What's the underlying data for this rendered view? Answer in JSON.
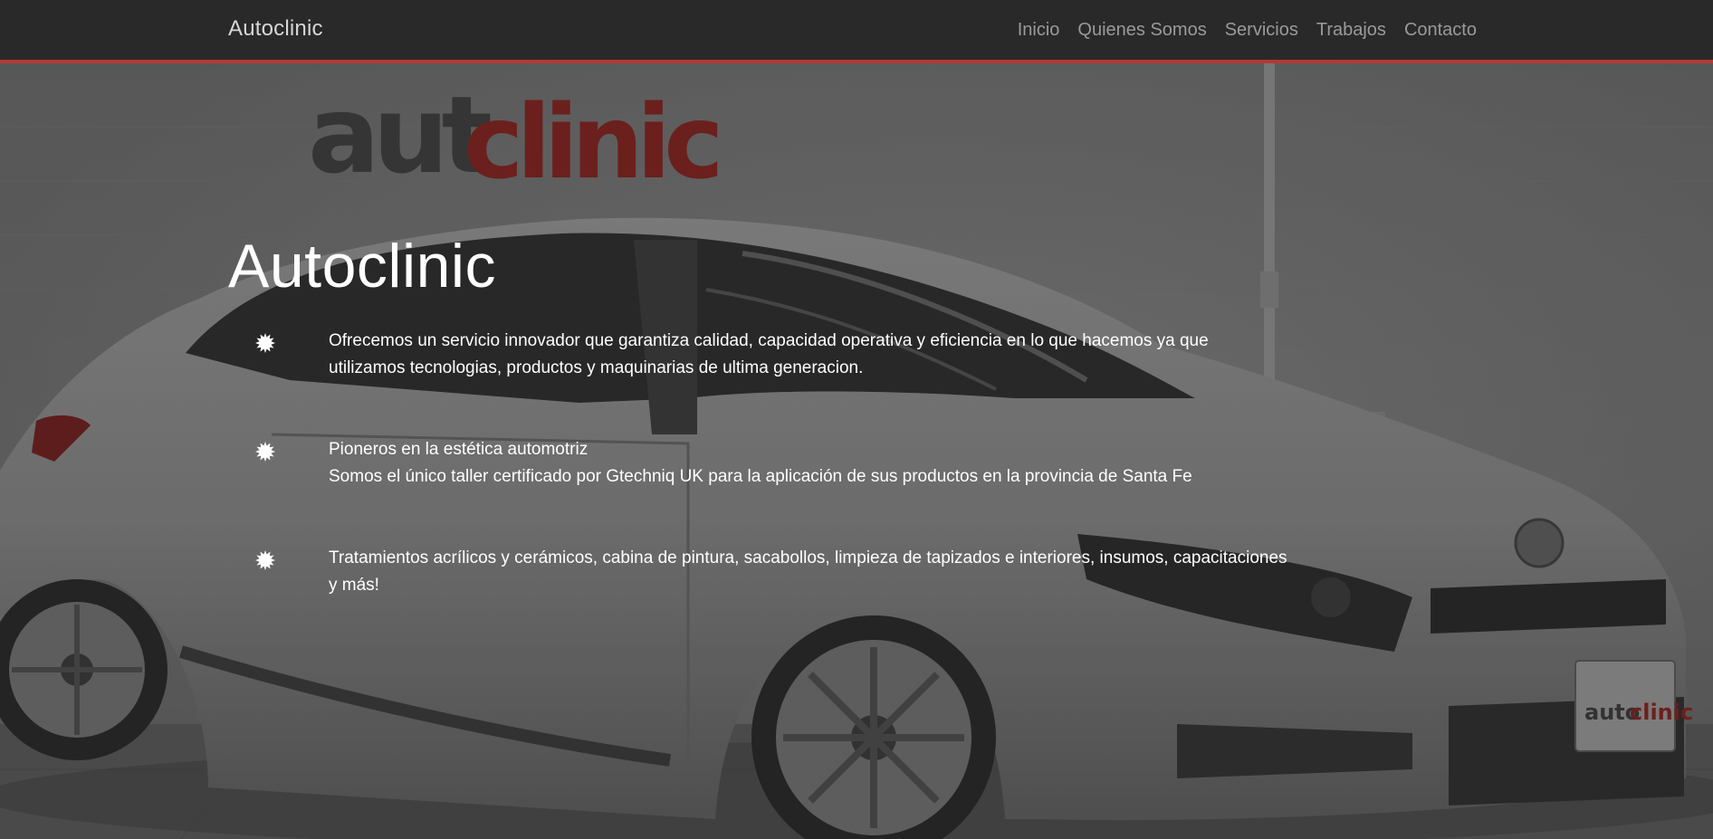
{
  "navbar": {
    "brand": "Autoclinic",
    "links": [
      "Inicio",
      "Quienes Somos",
      "Servicios",
      "Trabajos",
      "Contacto"
    ]
  },
  "hero": {
    "title": "Autoclinic",
    "features": [
      {
        "lines": [
          "Ofrecemos un servicio innovador que garantiza calidad, capacidad operativa y eficiencia en lo que hacemos ya que utilizamos tecnologias, productos y maquinarias de ultima generacion."
        ]
      },
      {
        "lines": [
          "Pioneros en la estética automotriz",
          "Somos el único taller certificado por Gtechniq UK para la aplicación de sus productos en la provincia de Santa Fe"
        ]
      },
      {
        "lines": [
          "Tratamientos acrílicos y cerámicos, cabina de pintura, sacabollos, limpieza de tapizados e interiores, insumos, capacitaciones y más!"
        ]
      }
    ]
  },
  "background": {
    "wall_logo_dark": "aut",
    "wall_logo_red": "clinic",
    "plate_dark": "auto",
    "plate_red": "clinic"
  },
  "colors": {
    "navbar_bg": "#292929",
    "navbar_border": "#b23a33",
    "brand_red": "#c0302b",
    "text": "#ffffff",
    "nav_link": "#9a9a9a"
  },
  "icons": {
    "feature_bullet": "burst-star-icon"
  }
}
